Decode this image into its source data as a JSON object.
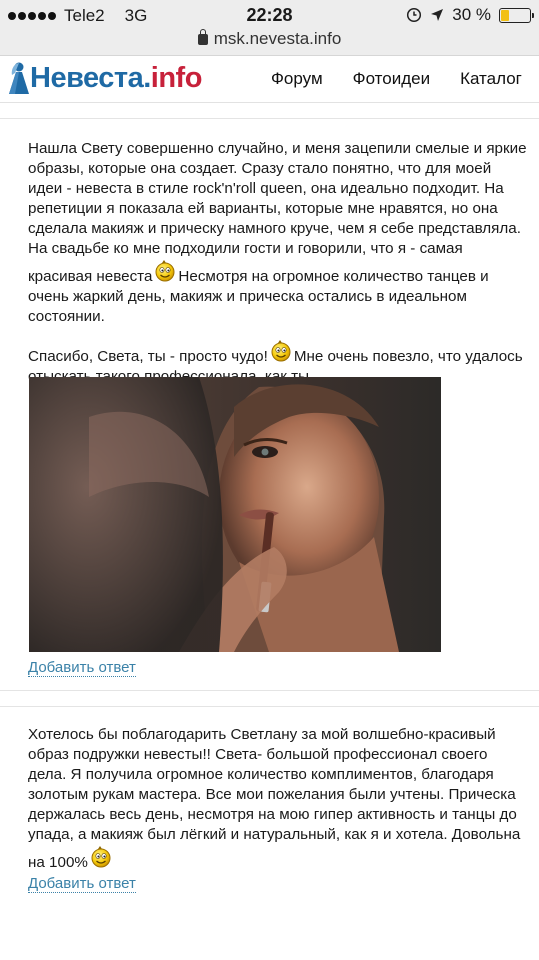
{
  "status_bar": {
    "carrier": "Tele2",
    "network": "3G",
    "time": "22:28",
    "battery": "30 %",
    "battery_level": 0.3,
    "url": "msk.nevesta.info"
  },
  "header": {
    "logo_part1": "Невеста.",
    "logo_part2": "info",
    "nav": [
      "Форум",
      "Фотоидеи",
      "Каталог"
    ]
  },
  "review1": {
    "para1_a": "Нашла Свету совершенно случайно, и меня зацепили смелые и яркие образы, которые она создает. Сразу стало понятно, что для моей идеи - невеста в стиле rock'n'roll queen, она идеально подходит. На репетиции я показала ей варианты, которые мне нравятся, но она сделала макияж и прическу намного круче, чем я себе представляла. На свадьбе ко мне подходили гости и говорили, что я - самая красивая невеста",
    "para1_b": "Несмотря на огромное количество танцев и очень жаркий день, макияж и прическа остались в идеальном состоянии.",
    "para2_a": "Спасибо, Света, ты - просто чудо!",
    "para2_b": "Мне очень повезло, что удалось отыскать такого профессионала, как ты.",
    "reply_label": "Добавить ответ"
  },
  "review2": {
    "para_a": "Хотелось бы поблагодарить Светлану за мой волшебно-красивый образ подружки невесты!! Света- большой профессионал своего дела. Я получила огромное количество комплиментов, благодаря золотым рукам мастера. Все мои пожелания были учтены. Прическа держалась весь день, несмотря на мою гипер активность и танцы до упада, а макияж был лёгкий и натуральный, как я и хотела. Довольна на 100%",
    "reply_label": "Добавить ответ"
  },
  "icons": [
    "lock-icon",
    "alarm-icon",
    "location-arrow-icon",
    "battery-icon",
    "bride-logo-icon",
    "smiley-icon"
  ],
  "colors": {
    "brand_blue": "#1f6aa5",
    "brand_red": "#c7213a",
    "link": "#3b82a8",
    "battery": "#f2c014"
  }
}
